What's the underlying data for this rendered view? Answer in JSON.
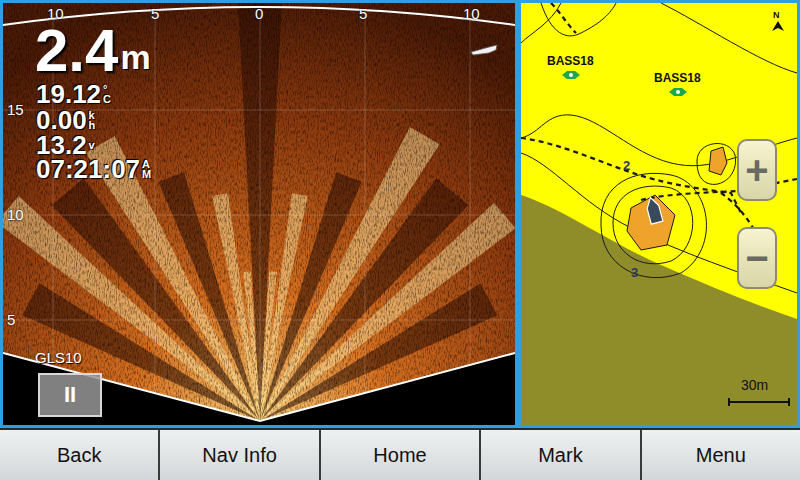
{
  "sonar": {
    "depth": {
      "value": "2.4",
      "unit": "m"
    },
    "readouts": [
      {
        "value": "19.12",
        "unit": [
          "°",
          "C"
        ]
      },
      {
        "value": "0.00",
        "unit": [
          "k",
          "h"
        ]
      },
      {
        "value": "13.2",
        "unit": [
          "v"
        ]
      },
      {
        "value": "07:21:07",
        "unit": [
          "A",
          "M"
        ]
      }
    ],
    "range_ticks": [
      "10",
      "5",
      "0",
      "5",
      "10"
    ],
    "depth_ticks": [
      "15",
      "10",
      "5"
    ],
    "transducer": "GLS10",
    "pause_button": "II"
  },
  "map": {
    "north": "N",
    "waypoints": [
      {
        "name": "BASS18"
      },
      {
        "name": "BASS18"
      }
    ],
    "depth_labels": [
      "2",
      "3"
    ],
    "zoom_in": "+",
    "zoom_out": "−",
    "scale": "30m"
  },
  "buttons": [
    "Back",
    "Nav Info",
    "Home",
    "Mark",
    "Menu"
  ]
}
